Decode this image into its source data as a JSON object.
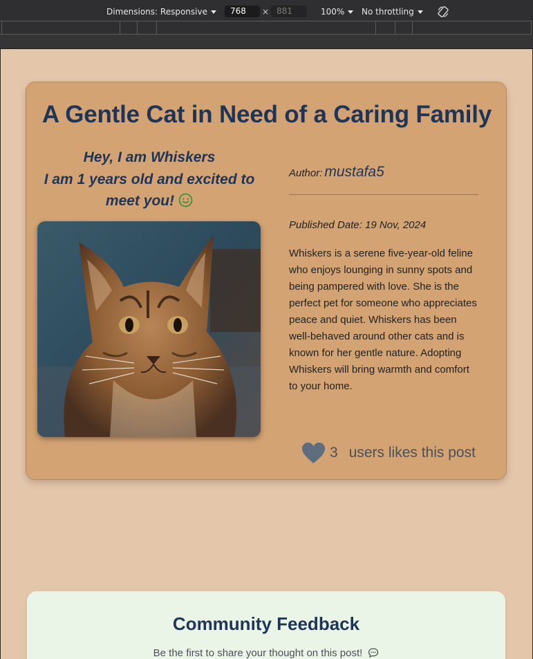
{
  "devtools": {
    "dimensions_label": "Dimensions: Responsive",
    "width": "768",
    "height": "881",
    "times": "×",
    "zoom": "100%",
    "throttling": "No throttling"
  },
  "post": {
    "title": "A Gentle Cat in Need of a Caring Family",
    "greeting_line1": "Hey, I am Whiskers",
    "greeting_line2": "I am 1 years old and excited to meet you!",
    "author_label": "Author:",
    "author_name": "mustafa5",
    "published": "Published Date: 19 Nov, 2024",
    "description": "Whiskers is a serene five-year-old feline who enjoys lounging in sunny spots and being pampered with love. She is the perfect pet for someone who appreciates peace and quiet. Whiskers has been well-behaved around other cats and is known for her gentle nature. Adopting Whiskers will bring warmth and comfort to your home.",
    "likes_count": "3",
    "likes_text": "users likes this post"
  },
  "feedback": {
    "title": "Community Feedback",
    "subtitle": "Be the first to share your thought on this post!"
  },
  "colors": {
    "page_bg": "#e4c6ab",
    "card_bg": "#d4a373",
    "heading": "#1f3557",
    "feedback_bg": "#ebf5e7",
    "smile": "#3a8a3a",
    "heart": "#5e6e7e"
  }
}
